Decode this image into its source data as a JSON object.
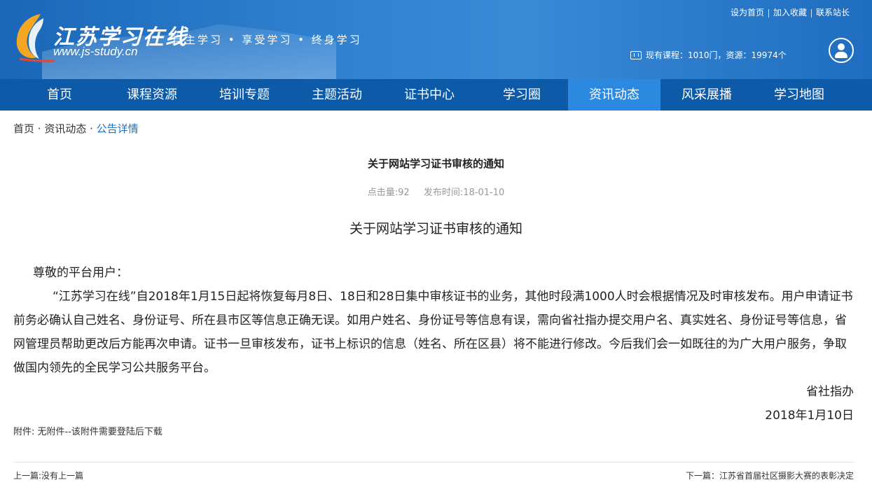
{
  "header": {
    "logo_title": "江苏学习在线",
    "logo_url": "www.js-study.cn",
    "slogan": "自主学习 • 享受学习 • 终身学习",
    "top_links": [
      "设为首页",
      "加入收藏",
      "联系站长"
    ],
    "stats": "现有课程：1010门，资源：19974个"
  },
  "nav": {
    "items": [
      "首页",
      "课程资源",
      "培训专题",
      "主题活动",
      "证书中心",
      "学习圈",
      "资讯动态",
      "风采展播",
      "学习地图"
    ],
    "active": "资讯动态"
  },
  "breadcrumb": {
    "home": "首页",
    "sep1": " · ",
    "section": "资讯动态",
    "sep2": " · ",
    "current": "公告详情"
  },
  "article": {
    "title": "关于网站学习证书审核的通知",
    "clicks": "点击量:92",
    "published": "发布时间:18-01-10",
    "heading": "关于网站学习证书审核的通知",
    "greeting": "尊敬的平台用户：",
    "body": "“江苏学习在线”自2018年1月15日起将恢复每月8日、18日和28日集中审核证书的业务，其他时段满1000人时会根据情况及时审核发布。用户申请证书前务必确认自己姓名、身份证号、所在县市区等信息正确无误。如用户姓名、身份证号等信息有误，需向省社指办提交用户名、真实姓名、身份证号等信息，省网管理员帮助更改后方能再次申请。证书一旦审核发布，证书上标识的信息（姓名、所在区县）将不能进行修改。今后我们会一如既往的为广大用户服务，争取做国内领先的全民学习公共服务平台。",
    "signature": "省社指办",
    "date": "2018年1月10日",
    "attachment_label": "附件:",
    "attachment_value": "无附件--该附件需要登陆后下载"
  },
  "pager": {
    "prev_label": "上一篇:",
    "prev_value": "没有上一篇",
    "next_label": "下一篇：",
    "next_value": "江苏省首届社区摄影大赛的表彰决定"
  }
}
